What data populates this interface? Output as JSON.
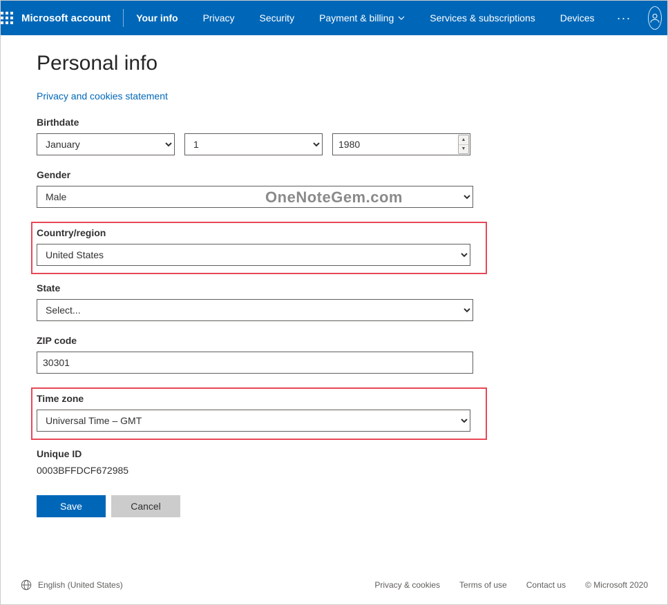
{
  "header": {
    "brand": "Microsoft account",
    "nav": {
      "your_info": "Your info",
      "privacy": "Privacy",
      "security": "Security",
      "payment": "Payment & billing",
      "services": "Services & subscriptions",
      "devices": "Devices"
    }
  },
  "page": {
    "title": "Personal info",
    "privacy_link": "Privacy and cookies statement",
    "birthdate_label": "Birthdate",
    "birth_month": "January",
    "birth_day": "1",
    "birth_year": "1980",
    "gender_label": "Gender",
    "gender_value": "Male",
    "country_label": "Country/region",
    "country_value": "United States",
    "state_label": "State",
    "state_value": "Select...",
    "zip_label": "ZIP code",
    "zip_value": "30301",
    "timezone_label": "Time zone",
    "timezone_value": "Universal Time – GMT",
    "uniqueid_label": "Unique ID",
    "uniqueid_value": "0003BFFDCF672985",
    "save": "Save",
    "cancel": "Cancel"
  },
  "watermark": "OneNoteGem.com",
  "footer": {
    "language": "English (United States)",
    "privacy": "Privacy & cookies",
    "terms": "Terms of use",
    "contact": "Contact us",
    "copyright": "© Microsoft 2020"
  }
}
